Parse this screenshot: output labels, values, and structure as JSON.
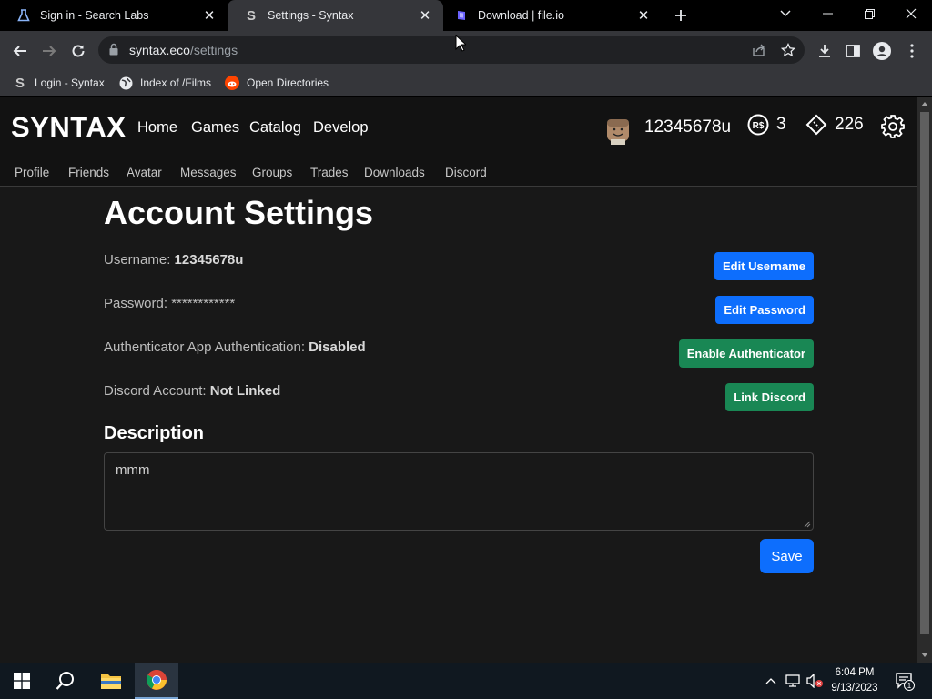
{
  "browser": {
    "tabs": [
      {
        "title": "Sign in - Search Labs",
        "favicon": "search-labs-icon",
        "active": false
      },
      {
        "title": "Settings - Syntax",
        "favicon": "syntax-s-icon",
        "active": true
      },
      {
        "title": "Download | file.io",
        "favicon": "fileio-icon",
        "active": false
      }
    ],
    "url_host": "syntax.eco",
    "url_path": "/settings",
    "bookmarks": [
      {
        "label": "Login - Syntax",
        "icon": "syntax-s-icon"
      },
      {
        "label": "Index of /Films",
        "icon": "globe-icon"
      },
      {
        "label": "Open Directories",
        "icon": "reddit-icon"
      }
    ]
  },
  "site": {
    "brand": "SYNTAX",
    "nav": [
      "Home",
      "Games",
      "Catalog",
      "Develop"
    ],
    "username": "12345678u",
    "robux": "3",
    "tickets": "226",
    "subnav": [
      "Profile",
      "Friends",
      "Avatar",
      "Messages",
      "Groups",
      "Trades",
      "Downloads",
      "Discord"
    ]
  },
  "settings": {
    "title": "Account Settings",
    "username_label": "Username:",
    "username_value": "12345678u",
    "password_label": "Password:",
    "password_value": "************",
    "auth_label": "Authenticator App Authentication:",
    "auth_value": "Disabled",
    "discord_label": "Discord Account:",
    "discord_value": "Not Linked",
    "edit_username": "Edit Username",
    "edit_password": "Edit Password",
    "enable_auth": "Enable Authenticator",
    "link_discord": "Link Discord",
    "description_heading": "Description",
    "description_value": "mmm",
    "save": "Save"
  },
  "taskbar": {
    "time": "6:04 PM",
    "date": "9/13/2023",
    "notification_count": "1"
  },
  "colors": {
    "primary": "#0d6efd",
    "success": "#198754",
    "page_bg": "#181818",
    "nav_bg": "#121212"
  }
}
